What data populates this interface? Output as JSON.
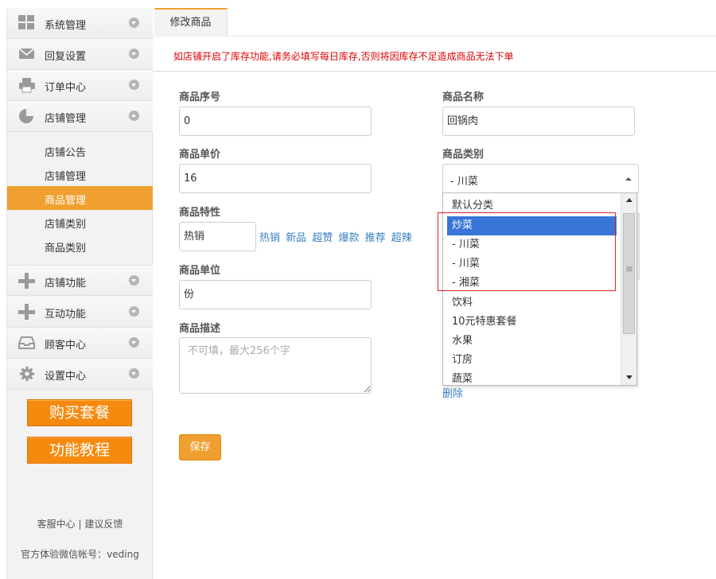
{
  "sidebar": {
    "menu": [
      {
        "label": "系统管理",
        "icon": "grid-icon"
      },
      {
        "label": "回复设置",
        "icon": "mail-icon"
      },
      {
        "label": "订单中心",
        "icon": "printer-icon"
      },
      {
        "label": "店铺管理",
        "icon": "pie-chart-icon"
      }
    ],
    "submenu": [
      "店铺公告",
      "店铺管理",
      "商品管理",
      "店铺类别",
      "商品类别"
    ],
    "menu2": [
      {
        "label": "店铺功能",
        "icon": "plus-icon"
      },
      {
        "label": "互动功能",
        "icon": "plus-icon"
      },
      {
        "label": "顾客中心",
        "icon": "inbox-icon"
      },
      {
        "label": "设置中心",
        "icon": "gear-icon"
      }
    ],
    "buy_button": "购买套餐",
    "tutorial_button": "功能教程",
    "service_link": "客服中心",
    "separator": "|",
    "feedback_link": "建议反馈",
    "wechat_label": "官方体验微信帐号：veding"
  },
  "tab": {
    "label": "修改商品"
  },
  "notice": "如店铺开启了库存功能,请务必填写每日库存,否则将因库存不足造成商品无法下单",
  "form": {
    "seq_label": "商品序号",
    "seq_value": "0",
    "name_label": "商品名称",
    "name_value": "回锅肉",
    "price_label": "商品单价",
    "price_value": "16",
    "category_label": "商品类别",
    "category_value": "- 川菜",
    "feature_label": "商品特性",
    "feature_value": "热销",
    "feature_tags": [
      "热销",
      "新品",
      "超赞",
      "爆款",
      "推荐",
      "超辣"
    ],
    "unit_label": "商品单位",
    "unit_value": "份",
    "desc_label": "商品描述",
    "desc_placeholder": "不可填，最大256个字",
    "delete_link": "删除",
    "save_button": "保存"
  },
  "dropdown": {
    "options": [
      "默认分类",
      "炒菜",
      "- 川菜",
      "- 川菜",
      "- 湘菜",
      "饮料",
      "10元特惠套餐",
      "水果",
      "订房",
      "蔬菜"
    ],
    "selected_index": 1
  },
  "colors": {
    "accent": "#f0a030",
    "button": "#f58a0f",
    "link": "#3a7fc1",
    "notice": "#e00000",
    "selection": "#3875d7"
  }
}
